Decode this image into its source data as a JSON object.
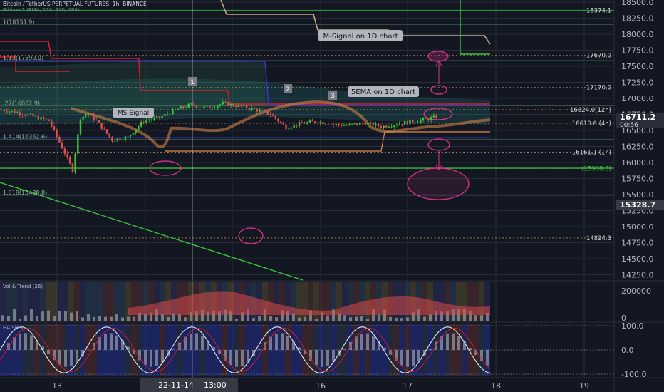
{
  "header": {
    "symbol_line": "Bitcoin / TetherUS PERPETUAL FUTURES, 1h, BINANCE",
    "indicator_line": "Ribbon 1 (EMA, 120, 240, 480)"
  },
  "colors": {
    "background": "#131722",
    "grid": "#2a2e39",
    "green": "#3ac63a",
    "red": "#d81b30",
    "blue": "#2a3cc8",
    "tan": "#c8a98a",
    "magenta": "#e0328a",
    "orange": "#e08a4a",
    "teal": "#2aa8a0"
  },
  "chart_data": {
    "type": "line",
    "title": "Bitcoin / TetherUS PERPETUAL FUTURES, 1h, BINANCE",
    "price_ticks": [
      "18500.0",
      "18250.0",
      "18000.0",
      "17750.0",
      "17500.0",
      "17250.0",
      "17000.0",
      "16750.0",
      "16500.0",
      "16250.0",
      "16000.0",
      "15750.0",
      "15500.0",
      "15250.0",
      "15000.0",
      "14750.0",
      "14500.0",
      "14250.0"
    ],
    "x_ticks": [
      "13",
      "14",
      "15",
      "16",
      "17",
      "18",
      "19"
    ],
    "crosshair_date": "22-11-14",
    "crosshair_time": "13:00",
    "last_price": "16711.2",
    "countdown": "00:56",
    "crosshair_price": "15328.7",
    "levels": [
      {
        "label": "18374.1",
        "price": 18374.1
      },
      {
        "label": "17670.0",
        "price": 17670.0
      },
      {
        "label": "17170.0",
        "price": 17170.0
      },
      {
        "label": "16824.0(12h)",
        "price": 16824.0
      },
      {
        "label": "16610.6 (4h)",
        "price": 16610.6
      },
      {
        "label": "16161.1 (1h)",
        "price": 16161.1
      },
      {
        "label": "(15908.3)",
        "price": 15908.3
      },
      {
        "label": "14824.3",
        "price": 14824.3
      }
    ],
    "fib_labels": [
      {
        "label": "1(18151.9)",
        "price": 18151.9
      },
      {
        "label": "1.13(17590.0)",
        "price": 17590.0
      },
      {
        "label": ".27(16882.9)",
        "price": 16882.9
      },
      {
        "label": "1.414(16362.6)",
        "price": 16362.6
      },
      {
        "label": "1.618(15488.8)",
        "price": 15488.8
      }
    ],
    "annotations": [
      "M-Signal on 1D chart",
      "5EMA on 1D chart",
      "MS-Signal",
      "1",
      "2",
      "3"
    ],
    "price_series": {
      "hour_index": [
        0,
        6,
        12,
        18,
        24,
        27,
        30,
        33,
        36,
        42,
        48,
        54,
        60,
        66,
        72,
        78,
        84,
        90,
        96,
        102,
        108,
        114,
        120,
        126,
        132,
        138,
        144,
        150,
        156,
        162,
        165
      ],
      "close": [
        16820,
        16780,
        16720,
        16650,
        16150,
        15880,
        16700,
        16760,
        16650,
        16350,
        16400,
        16650,
        16700,
        16820,
        16900,
        16850,
        16920,
        16880,
        16830,
        16750,
        16550,
        16610,
        16640,
        16590,
        16580,
        16620,
        16560,
        16600,
        16640,
        16680,
        16711.2
      ]
    },
    "volume_panel": {
      "title": "Vol & Trend (26)",
      "ticks": [
        "200000",
        "0"
      ]
    },
    "oscillator_panel": {
      "title": "HA SRSC",
      "ticks": [
        "100.0",
        "0.0",
        "-100.0"
      ]
    }
  }
}
